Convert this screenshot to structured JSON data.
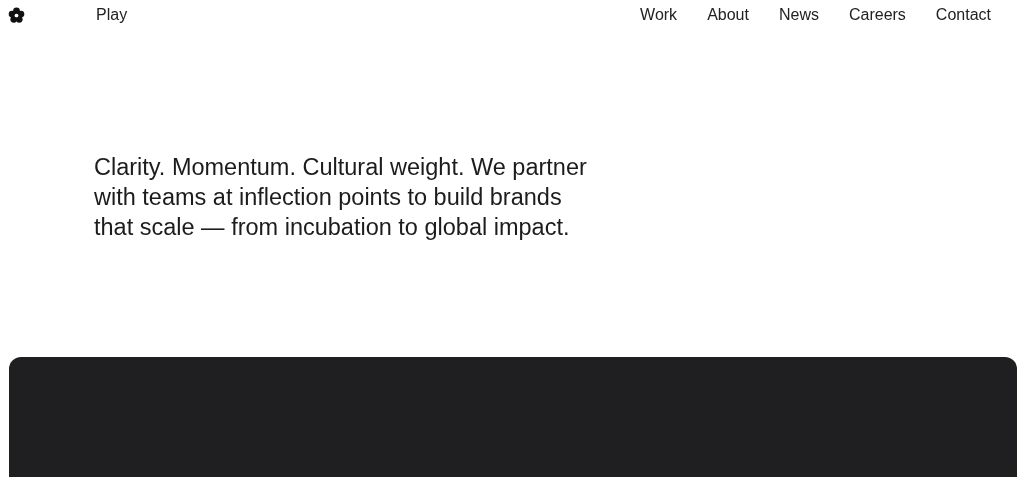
{
  "header": {
    "secondary_link": "Play",
    "nav": [
      {
        "label": "Work"
      },
      {
        "label": "About"
      },
      {
        "label": "News"
      },
      {
        "label": "Careers"
      },
      {
        "label": "Contact"
      }
    ]
  },
  "intro": {
    "text": "Clarity. Momentum. Cultural weight. We partner with teams at inflection points to build brands that scale — from incubation to global impact."
  },
  "showcase": {
    "kind": "panel"
  }
}
